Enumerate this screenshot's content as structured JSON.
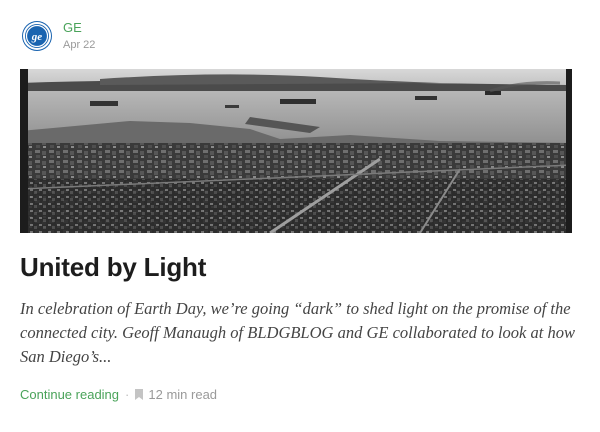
{
  "post": {
    "author": "GE",
    "date": "Apr 22",
    "title": "United by Light",
    "excerpt": "In celebration of Earth Day, we’re going “dark” to shed light on the promise of the connected city. Geoff Manaugh of BLDGBLOG and GE collaborated to look at how San Diego’s...",
    "continue_label": "Continue reading",
    "separator": "·",
    "read_time": "12 min read"
  },
  "icons": {
    "avatar": "ge-logo-icon",
    "bookmark": "bookmark-icon"
  },
  "colors": {
    "accent": "#4aa35a",
    "brand_ge": "#1a64b0",
    "muted_text": "#9a9a9a",
    "title_text": "#1d1d1d"
  }
}
